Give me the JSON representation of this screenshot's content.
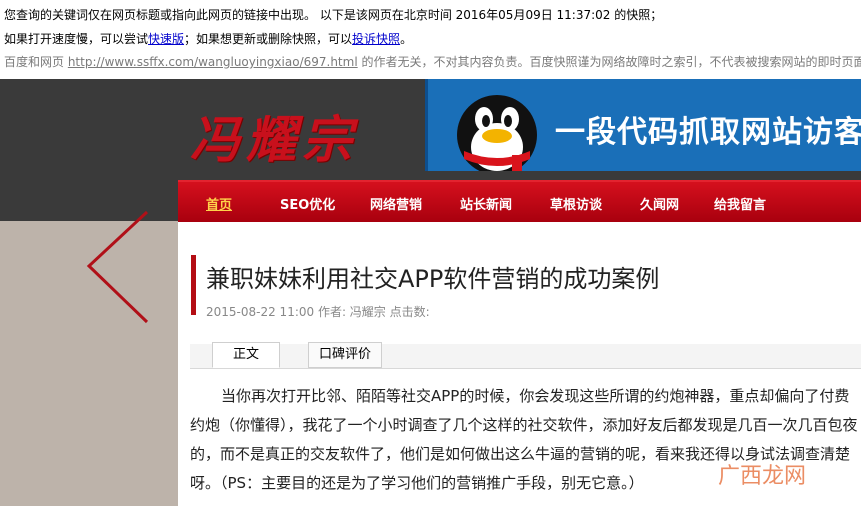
{
  "snapshot": {
    "line1": "您查询的关键词仅在网页标题或指向此网页的链接中出现。   以下是该网页在北京时间 2016年05月09日 11:37:02 的快照；",
    "line2_prefix": "如果打开速度慢，可以尝试",
    "fast_link": "快速版",
    "line2_mid": "；如果想更新或删除快照，可以",
    "complain_link": "投诉快照",
    "line2_suffix": "。",
    "line3_prefix": "百度和网页 ",
    "source_url": "http://www.ssffx.com/wangluoyingxiao/697.html",
    "line3_suffix": " 的作者无关，不对其内容负责。百度快照谨为网络故障时之索引，不代表被搜索网站的即时页面"
  },
  "site": {
    "logo_text": "冯耀宗",
    "banner_text": "一段代码抓取网站访客"
  },
  "nav": {
    "items": [
      "首页",
      "SEO优化",
      "网络营销",
      "站长新闻",
      "草根访谈",
      "久闻网",
      "给我留言"
    ]
  },
  "article": {
    "title": "兼职妹妹利用社交APP软件营销的成功案例",
    "meta": "2015-08-22 11:00  作者: 冯耀宗  点击数:",
    "tab_main": "正文",
    "tab_review": "口碑评价",
    "paragraph": "当你再次打开比邻、陌陌等社交APP的时候，你会发现这些所谓的约炮神器，重点却偏向了付费约炮（你懂得），我花了一个小时调查了几个这样的社交软件，添加好友后都发现是几百一次几百包夜的，而不是真正的交友软件了，他们是如何做出这么牛逼的营销的呢，看来我还得以身试法调查清楚呀。（PS：主要目的还是为了学习他们的营销推广手段，别无它意。）"
  },
  "watermark": "广西龙网",
  "colors": {
    "nav_red": "#c8101c",
    "banner_blue": "#1a6fb8",
    "link_blue": "#0000cc"
  }
}
